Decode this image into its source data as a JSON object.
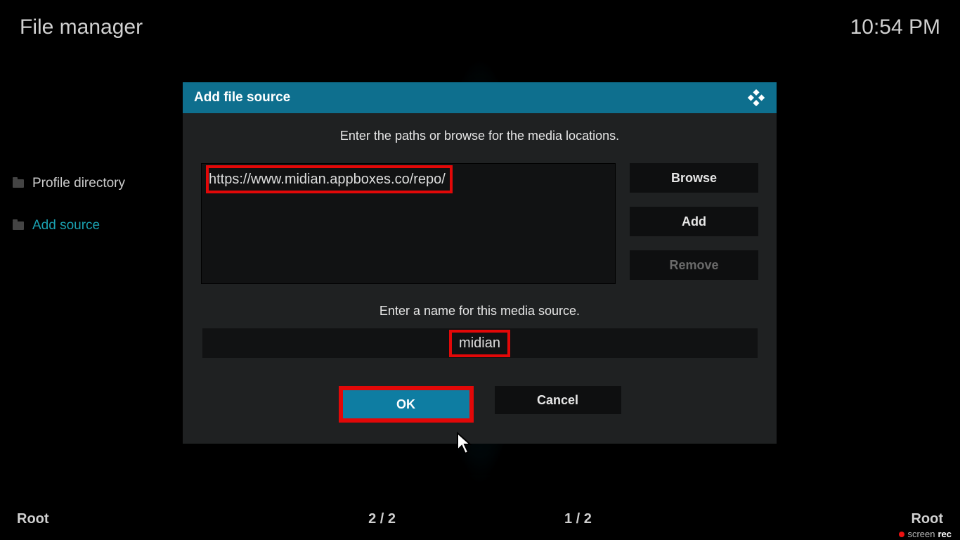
{
  "header": {
    "title": "File manager",
    "clock": "10:54 PM"
  },
  "sidebar": {
    "items": [
      {
        "label": "Profile directory",
        "active": false
      },
      {
        "label": "Add source",
        "active": true
      }
    ]
  },
  "dialog": {
    "title": "Add file source",
    "prompt_paths": "Enter the paths or browse for the media locations.",
    "path_value": "https://www.midian.appboxes.co/repo/",
    "browse": "Browse",
    "add": "Add",
    "remove": "Remove",
    "prompt_name": "Enter a name for this media source.",
    "name_value": "midian",
    "ok": "OK",
    "cancel": "Cancel"
  },
  "footer": {
    "left_root": "Root",
    "left_count": "2 / 2",
    "right_count": "1 / 2",
    "right_root": "Root"
  },
  "watermark": {
    "screen": "screen",
    "rec": "rec"
  }
}
